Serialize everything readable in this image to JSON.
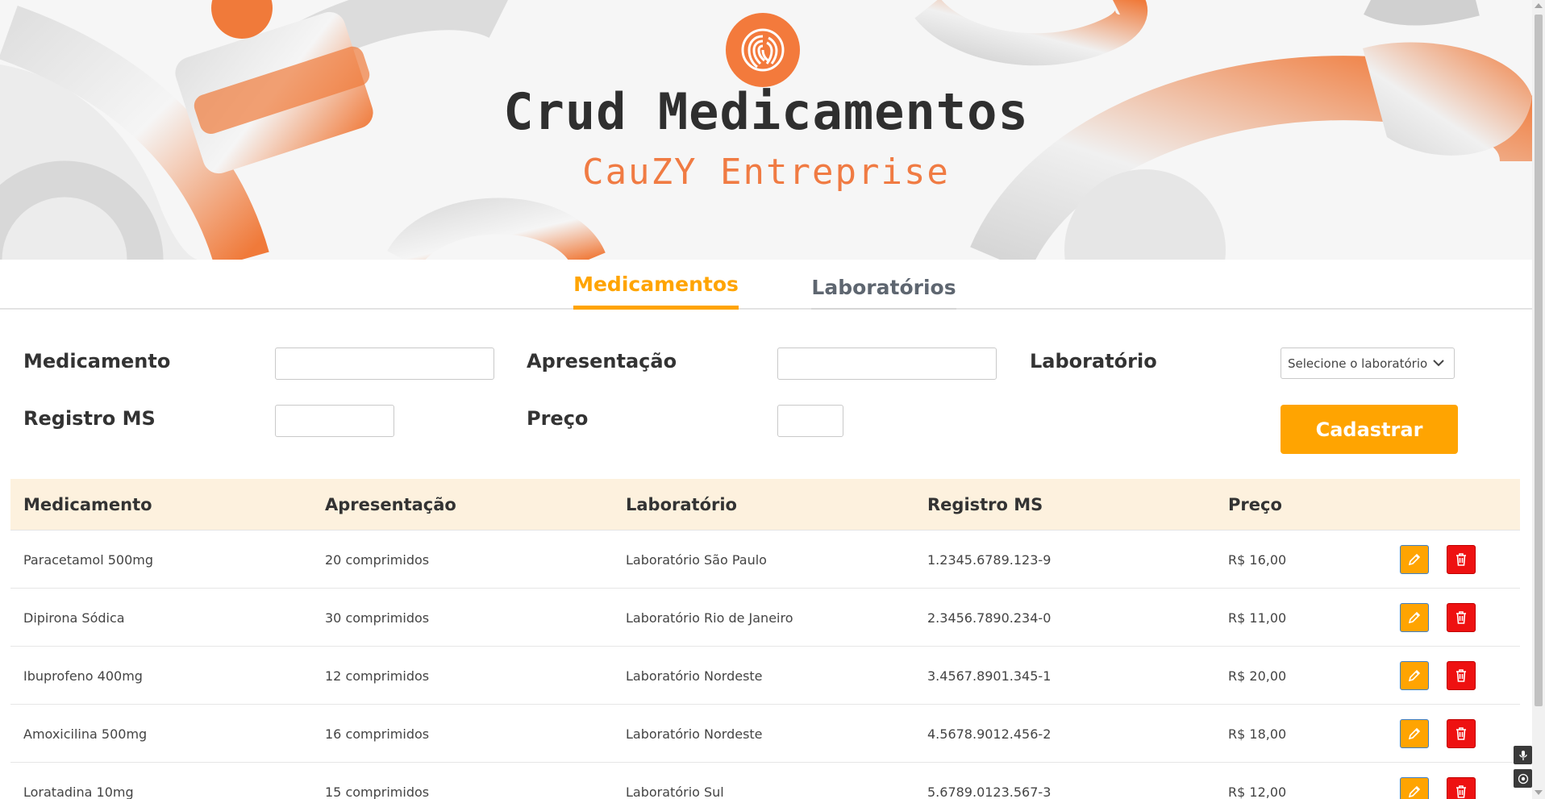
{
  "banner": {
    "title": "Crud Medicamentos",
    "subtitle": "CauZY Entreprise"
  },
  "tabs": [
    {
      "label": "Medicamentos",
      "active": true
    },
    {
      "label": "Laboratórios",
      "active": false
    }
  ],
  "form": {
    "medicamento_label": "Medicamento",
    "medicamento_value": "",
    "apresentacao_label": "Apresentação",
    "apresentacao_value": "",
    "laboratorio_label": "Laboratório",
    "laboratorio_select": "Selecione o laboratório",
    "registro_label": "Registro MS",
    "registro_value": "",
    "preco_label": "Preço",
    "preco_value": "",
    "submit_label": "Cadastrar"
  },
  "table": {
    "headers": [
      "Medicamento",
      "Apresentação",
      "Laboratório",
      "Registro MS",
      "Preço"
    ],
    "rows": [
      {
        "medicamento": "Paracetamol 500mg",
        "apresentacao": "20 comprimidos",
        "laboratorio": "Laboratório São Paulo",
        "registro": "1.2345.6789.123-9",
        "preco": "R$ 16,00"
      },
      {
        "medicamento": "Dipirona Sódica",
        "apresentacao": "30 comprimidos",
        "laboratorio": "Laboratório Rio de Janeiro",
        "registro": "2.3456.7890.234-0",
        "preco": "R$ 11,00"
      },
      {
        "medicamento": "Ibuprofeno 400mg",
        "apresentacao": "12 comprimidos",
        "laboratorio": "Laboratório Nordeste",
        "registro": "3.4567.8901.345-1",
        "preco": "R$ 20,00"
      },
      {
        "medicamento": "Amoxicilina 500mg",
        "apresentacao": "16 comprimidos",
        "laboratorio": "Laboratório Nordeste",
        "registro": "4.5678.9012.456-2",
        "preco": "R$ 18,00"
      },
      {
        "medicamento": "Loratadina 10mg",
        "apresentacao": "15 comprimidos",
        "laboratorio": "Laboratório Sul",
        "registro": "5.6789.0123.567-3",
        "preco": "R$ 12,00"
      }
    ]
  },
  "colors": {
    "accent": "#ffa401",
    "delete": "#ee1111",
    "header_bg": "#fdf1de",
    "brand_orange": "#f07b43"
  },
  "icons": {
    "edit": "pencil-icon",
    "delete": "trash-icon",
    "logo": "fingerprint-icon"
  }
}
